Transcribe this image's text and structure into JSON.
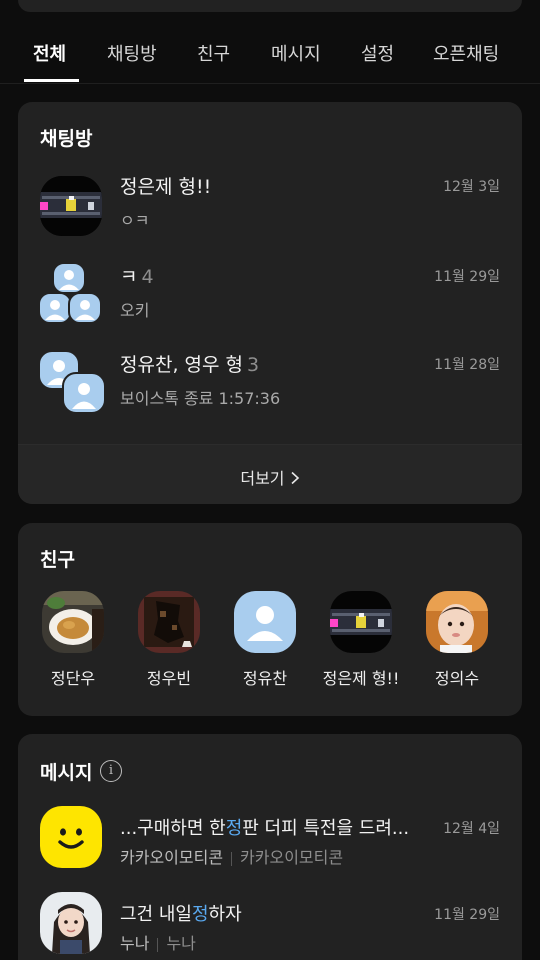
{
  "tabs": [
    "전체",
    "채팅방",
    "친구",
    "메시지",
    "설정",
    "오픈채팅"
  ],
  "active_tab": "전체",
  "chatrooms": {
    "title": "채팅방",
    "items": [
      {
        "name": "정은제 형!!",
        "count": "",
        "preview": "ㅇㅋ",
        "time": "12월 3일",
        "avatar": "game-screenshot"
      },
      {
        "name": "ㅋ",
        "count": "4",
        "preview": "오키",
        "time": "11월 29일",
        "avatar": "group-of-3"
      },
      {
        "name": "정유찬, 영우 형",
        "count": "3",
        "preview": "보이스톡 종료 1:57:36",
        "time": "11월 28일",
        "avatar": "group-of-2"
      }
    ],
    "more_label": "더보기",
    "more_icon": "chevron-right-icon"
  },
  "friends": {
    "title": "친구",
    "items": [
      {
        "name": "정단우",
        "avatar": "food-photo"
      },
      {
        "name": "정우빈",
        "avatar": "dark-photo"
      },
      {
        "name": "정유찬",
        "avatar": "default-person"
      },
      {
        "name": "정은제 형!!",
        "avatar": "game-screenshot"
      },
      {
        "name": "정의수",
        "avatar": "baby-photo"
      }
    ]
  },
  "messages": {
    "title": "메시지",
    "info_icon": "info-icon",
    "items": [
      {
        "text_before": "...구매하면 한",
        "text_highlight": "정",
        "text_after": "판 더피 특전을 드려...",
        "sender": "카카오이모티콘",
        "sub": "카카오이모티콘",
        "time": "12월 4일",
        "avatar": "kakao-smiley"
      },
      {
        "text_before": "그건 내일",
        "text_highlight": "정",
        "text_after": "하자",
        "sender": "누나",
        "sub": "누나",
        "time": "11월 29일",
        "avatar": "girl-photo"
      }
    ]
  },
  "colors": {
    "background": "#0d0d0d",
    "card": "#222222",
    "highlight": "#5aa9f0",
    "avatar_blue": "#a9cdee",
    "kakao_yellow": "#fee500"
  }
}
